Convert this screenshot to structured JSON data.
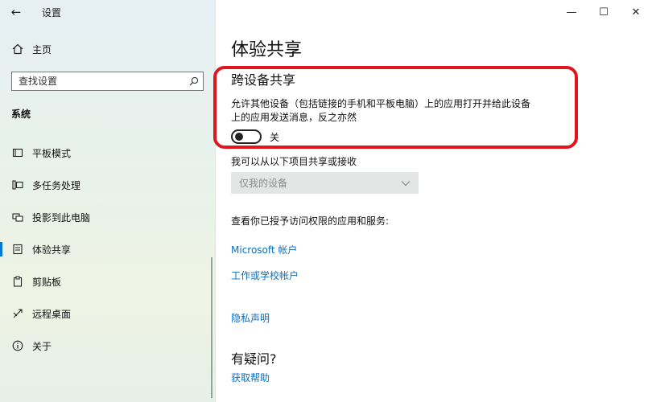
{
  "window": {
    "title": "设置",
    "back_glyph": "←",
    "minimize_glyph": "—",
    "maximize_glyph": "☐",
    "close_glyph": "✕"
  },
  "sidebar": {
    "home_label": "主页",
    "search_placeholder": "查找设置",
    "section_title": "系统",
    "items": [
      {
        "label": "平板模式",
        "icon": "tablet-icon",
        "active": false
      },
      {
        "label": "多任务处理",
        "icon": "multitask-icon",
        "active": false
      },
      {
        "label": "投影到此电脑",
        "icon": "project-icon",
        "active": false
      },
      {
        "label": "体验共享",
        "icon": "share-icon",
        "active": true
      },
      {
        "label": "剪贴板",
        "icon": "clipboard-icon",
        "active": false
      },
      {
        "label": "远程桌面",
        "icon": "remote-desktop-icon",
        "active": false
      },
      {
        "label": "关于",
        "icon": "info-icon",
        "active": false
      }
    ]
  },
  "main": {
    "page_title": "体验共享",
    "group_title": "跨设备共享",
    "description": "允许其他设备（包括链接的手机和平板电脑）上的应用打开并给此设备上的应用发送消息，反之亦然",
    "toggle_state": "关",
    "toggle_on": false,
    "share_label": "我可以从以下项目共享或接收",
    "dropdown_value": "仅我的设备",
    "permission_text": "查看你已授予访问权限的应用和服务:",
    "link_microsoft": "Microsoft 帐户",
    "link_work": "工作或学校帐户",
    "link_privacy": "隐私声明",
    "question_title": "有疑问?",
    "link_help": "获取帮助"
  },
  "colors": {
    "accent": "#0078d4",
    "link": "#0a6fc2",
    "highlight": "#e0161e"
  }
}
